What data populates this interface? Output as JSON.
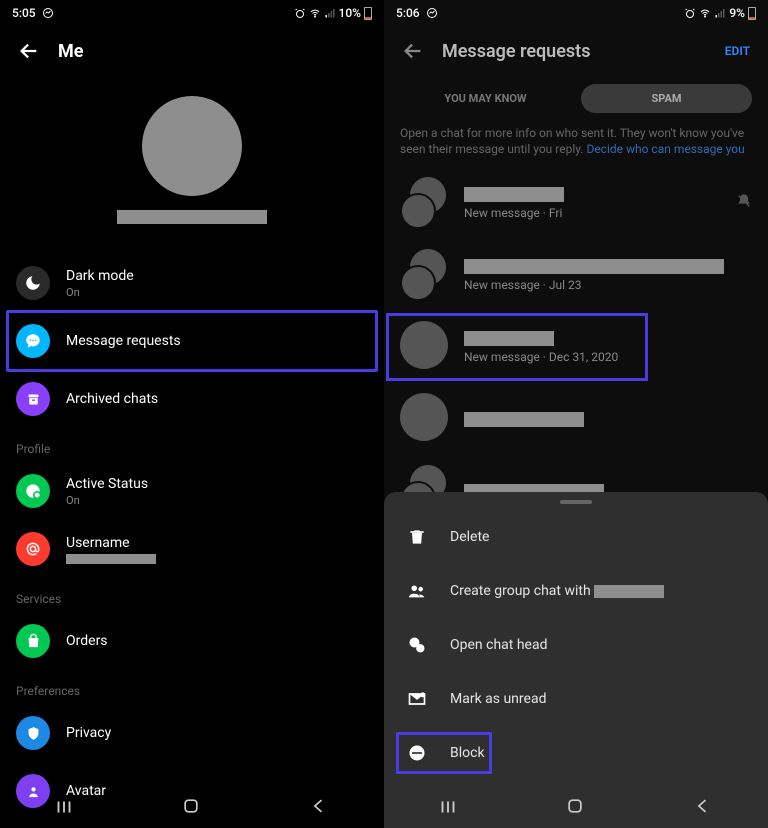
{
  "left": {
    "status": {
      "time": "5:05",
      "battery_pct": "10%"
    },
    "title": "Me",
    "menu": {
      "dark_mode": {
        "label": "Dark mode",
        "sub": "On"
      },
      "message_requests": {
        "label": "Message requests"
      },
      "archived_chats": {
        "label": "Archived chats"
      }
    },
    "sections": {
      "profile_label": "Profile",
      "active_status": {
        "label": "Active Status",
        "sub": "On"
      },
      "username": {
        "label": "Username"
      },
      "services_label": "Services",
      "orders": {
        "label": "Orders"
      },
      "preferences_label": "Preferences",
      "privacy": {
        "label": "Privacy"
      },
      "avatar": {
        "label": "Avatar"
      }
    }
  },
  "right": {
    "status": {
      "time": "5:06",
      "battery_pct": "9%"
    },
    "title": "Message requests",
    "edit": "EDIT",
    "tabs": {
      "know": "YOU MAY KNOW",
      "spam": "SPAM"
    },
    "info": {
      "text": "Open a chat for more info on who sent it. They won't know you've seen their message until you reply. ",
      "link": "Decide who can message you"
    },
    "rows": [
      {
        "sub": "New message · Fri",
        "name_w": 100,
        "double": true,
        "muted": true
      },
      {
        "sub": "New message · Jul 23",
        "name_w": 260,
        "double": true
      },
      {
        "sub": "New message · Dec 31, 2020",
        "name_w": 90,
        "double": false,
        "hl": true
      },
      {
        "sub": "",
        "name_w": 120,
        "double": false
      },
      {
        "sub": "",
        "name_w": 140,
        "double": true
      }
    ],
    "sheet": {
      "delete": "Delete",
      "group": "Create group chat with ",
      "open_head": "Open chat head",
      "unread": "Mark as unread",
      "block": "Block"
    }
  }
}
